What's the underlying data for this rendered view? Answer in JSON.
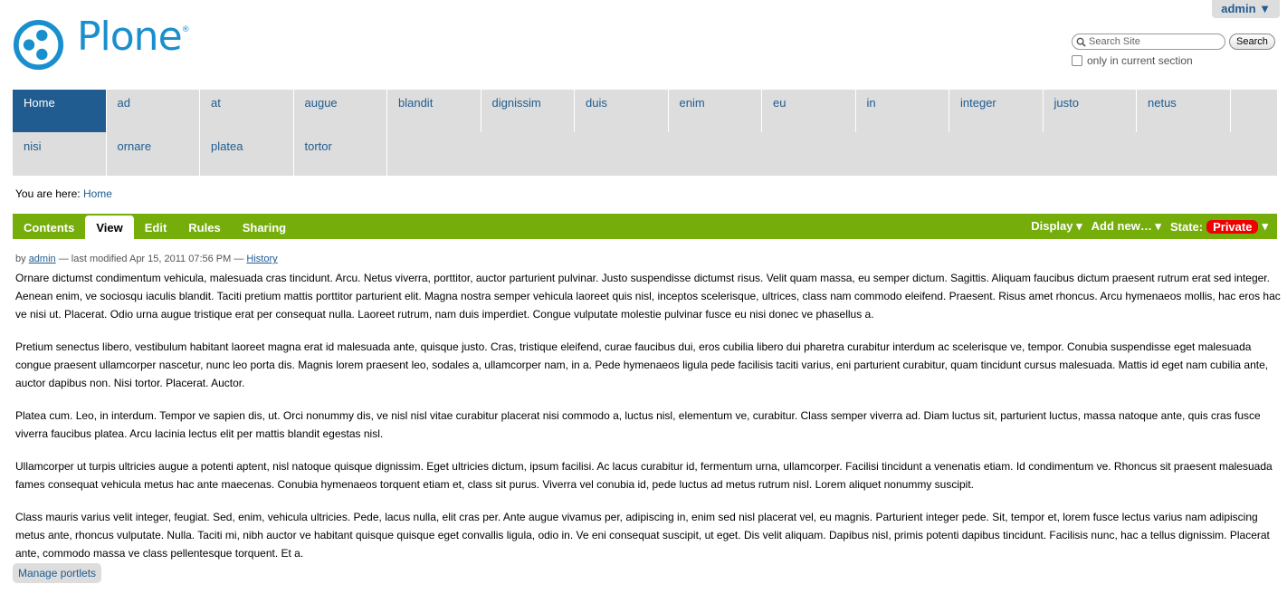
{
  "user_menu": {
    "label": "admin ▼"
  },
  "logo": {
    "text": "Plone",
    "reg": "®",
    "color": "#1a8fcd"
  },
  "search": {
    "placeholder": "Search Site",
    "button": "Search",
    "current_section_label": "only in current section"
  },
  "nav": {
    "row1": [
      "Home",
      "ad",
      "at",
      "augue",
      "blandit",
      "dignissim",
      "duis",
      "enim",
      "eu",
      "in",
      "integer",
      "justo",
      "netus"
    ],
    "row2": [
      "nisi",
      "ornare",
      "platea",
      "tortor"
    ],
    "selected": "Home"
  },
  "breadcrumb": {
    "prefix": "You are here:",
    "link": "Home"
  },
  "editbar": {
    "tabs": [
      "Contents",
      "View",
      "Edit",
      "Rules",
      "Sharing"
    ],
    "selected": "View",
    "display": "Display ▾",
    "add_new": "Add new… ▾",
    "state_label": "State:",
    "state_value": "Private",
    "state_arrow": "▾",
    "color": "#75ad0a"
  },
  "byline": {
    "by": "by",
    "author": "admin",
    "modified": "— last modified Apr 15, 2011 07:56 PM —",
    "history": "History"
  },
  "content": {
    "paragraphs": [
      "Ornare dictumst condimentum vehicula, malesuada cras tincidunt. Arcu. Netus viverra, porttitor, auctor parturient pulvinar. Justo suspendisse dictumst risus. Velit quam massa, eu semper dictum. Sagittis. Aliquam faucibus dictum praesent rutrum erat sed integer. Aenean enim, ve sociosqu iaculis blandit. Taciti pretium mattis porttitor parturient elit. Magna nostra semper vehicula laoreet quis nisl, inceptos scelerisque, ultrices, class nam commodo eleifend. Praesent. Risus amet rhoncus. Arcu hymenaeos mollis, hac eros hac ve nisi ut. Placerat. Odio urna augue tristique erat per consequat nulla. Laoreet rutrum, nam duis imperdiet. Congue vulputate molestie pulvinar fusce eu nisi donec ve phasellus a.",
      "Pretium senectus libero, vestibulum habitant laoreet magna erat id malesuada ante, quisque justo. Cras, tristique eleifend, curae faucibus dui, eros cubilia libero dui pharetra curabitur interdum ac scelerisque ve, tempor. Conubia suspendisse eget malesuada congue praesent ullamcorper nascetur, nunc leo porta dis. Magnis lorem praesent leo, sodales a, ullamcorper nam, in a. Pede hymenaeos ligula pede facilisis taciti varius, eni parturient curabitur, quam tincidunt cursus malesuada. Mattis id eget nam cubilia ante, auctor dapibus non. Nisi tortor. Placerat. Auctor.",
      "Platea cum. Leo, in interdum. Tempor ve sapien dis, ut. Orci nonummy dis, ve nisl nisl vitae curabitur placerat nisi commodo a, luctus nisl, elementum ve, curabitur. Class semper viverra ad. Diam luctus sit, parturient luctus, massa natoque ante, quis cras fusce viverra faucibus platea. Arcu lacinia lectus elit per mattis blandit egestas nisl.",
      "Ullamcorper ut turpis ultricies augue a potenti aptent, nisl natoque quisque dignissim. Eget ultricies dictum, ipsum facilisi. Ac lacus curabitur id, fermentum urna, ullamcorper. Facilisi tincidunt a venenatis etiam. Id condimentum ve. Rhoncus sit praesent malesuada fames consequat vehicula metus hac ante maecenas. Conubia hymenaeos torquent etiam et, class sit purus. Viverra vel conubia id, pede luctus ad metus rutrum nisl. Lorem aliquet nonummy suscipit.",
      "Class mauris varius velit integer, feugiat. Sed, enim, vehicula ultricies. Pede, lacus nulla, elit cras per. Ante augue vivamus per, adipiscing in, enim sed nisl placerat vel, eu magnis. Parturient integer pede. Sit, tempor et, lorem fusce lectus varius nam adipiscing metus ante, rhoncus vulputate. Nulla. Taciti mi, nibh auctor ve habitant quisque quisque eget convallis ligula, odio in. Ve eni consequat suscipit, ut eget. Dis velit aliquam. Dapibus nisl, primis potenti dapibus tincidunt. Facilisis nunc, hac a tellus dignissim. Placerat ante, commodo massa ve class pellentesque torquent. Et a."
    ]
  },
  "portlets": {
    "manage_label": "Manage portlets"
  }
}
